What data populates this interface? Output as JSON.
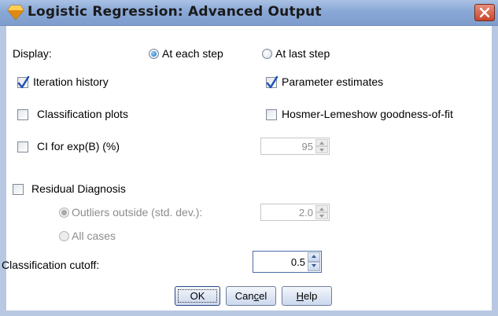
{
  "window": {
    "title": "Logistic Regression: Advanced Output"
  },
  "display": {
    "label": "Display:",
    "options": [
      {
        "label": "At each step",
        "selected": true
      },
      {
        "label": "At last step",
        "selected": false
      }
    ]
  },
  "checkboxes": {
    "iteration_history": {
      "label": "Iteration history",
      "checked": true
    },
    "parameter_estimates": {
      "label": "Parameter estimates",
      "checked": true
    },
    "classification_plots": {
      "label": "Classification plots",
      "checked": false
    },
    "hosmer_lemeshow": {
      "label": "Hosmer-Lemeshow goodness-of-fit",
      "checked": false
    },
    "ci_exp_b": {
      "label": "CI for exp(B) (%)",
      "checked": false,
      "value": "95"
    },
    "residual_diagnosis": {
      "label": "Residual Diagnosis",
      "checked": false
    }
  },
  "residual": {
    "outliers": {
      "label": "Outliers outside (std. dev.):",
      "selected": true,
      "value": "2.0"
    },
    "all_cases": {
      "label": "All cases",
      "selected": false
    }
  },
  "cutoff": {
    "label": "Classification cutoff:",
    "value": "0.5"
  },
  "buttons": {
    "ok": "OK",
    "cancel_pre": "Can",
    "cancel_u": "c",
    "cancel_post": "el",
    "help_u": "H",
    "help_post": "elp"
  },
  "colors": {
    "titlebar": "#8aa8d6",
    "close": "#c8452d",
    "check": "#2355b7"
  }
}
